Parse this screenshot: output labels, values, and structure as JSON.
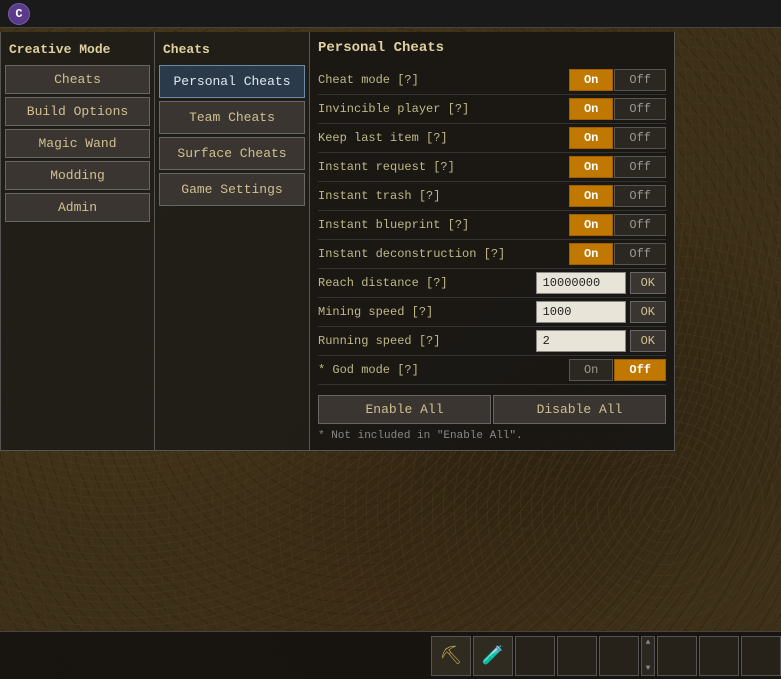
{
  "app": {
    "icon": "C",
    "title": "Creative Mode"
  },
  "sidebar_left": {
    "title": "Creative Mode",
    "buttons": [
      {
        "label": "Cheats",
        "id": "cheats"
      },
      {
        "label": "Build Options",
        "id": "build-options"
      },
      {
        "label": "Magic Wand",
        "id": "magic-wand"
      },
      {
        "label": "Modding",
        "id": "modding"
      },
      {
        "label": "Admin",
        "id": "admin"
      }
    ]
  },
  "sidebar_mid": {
    "title": "Cheats",
    "buttons": [
      {
        "label": "Personal Cheats",
        "id": "personal-cheats",
        "active": true
      },
      {
        "label": "Team Cheats",
        "id": "team-cheats",
        "active": false
      },
      {
        "label": "Surface Cheats",
        "id": "surface-cheats",
        "active": false
      },
      {
        "label": "Game Settings",
        "id": "game-settings",
        "active": false
      }
    ]
  },
  "panel_right": {
    "title": "Personal Cheats",
    "rows": [
      {
        "label": "Cheat mode [?]",
        "type": "toggle",
        "on": true
      },
      {
        "label": "Invincible player [?]",
        "type": "toggle",
        "on": true
      },
      {
        "label": "Keep last item [?]",
        "type": "toggle",
        "on": true
      },
      {
        "label": "Instant request [?]",
        "type": "toggle",
        "on": true
      },
      {
        "label": "Instant trash [?]",
        "type": "toggle",
        "on": true
      },
      {
        "label": "Instant blueprint [?]",
        "type": "toggle",
        "on": true
      },
      {
        "label": "Instant deconstruction [?]",
        "type": "toggle",
        "on": true
      },
      {
        "label": "Reach distance [?]",
        "type": "input",
        "value": "10000000"
      },
      {
        "label": "Mining speed [?]",
        "type": "input",
        "value": "1000"
      },
      {
        "label": "Running speed [?]",
        "type": "input",
        "value": "2"
      },
      {
        "label": "* God mode [?]",
        "type": "toggle-god",
        "on": false
      }
    ],
    "buttons": {
      "enable_all": "Enable All",
      "disable_all": "Disable All"
    },
    "footnote": "* Not included in \"Enable All\"."
  },
  "toolbar": {
    "slots": [
      {
        "has_item": true,
        "icon": "⛏"
      },
      {
        "has_item": true,
        "icon": "🧪"
      },
      {
        "has_item": false,
        "icon": ""
      },
      {
        "has_item": false,
        "icon": ""
      },
      {
        "has_item": false,
        "icon": ""
      },
      {
        "has_item": false,
        "icon": ""
      },
      {
        "has_item": false,
        "icon": ""
      },
      {
        "has_item": false,
        "icon": ""
      },
      {
        "has_item": false,
        "icon": ""
      },
      {
        "has_item": false,
        "icon": ""
      }
    ]
  }
}
